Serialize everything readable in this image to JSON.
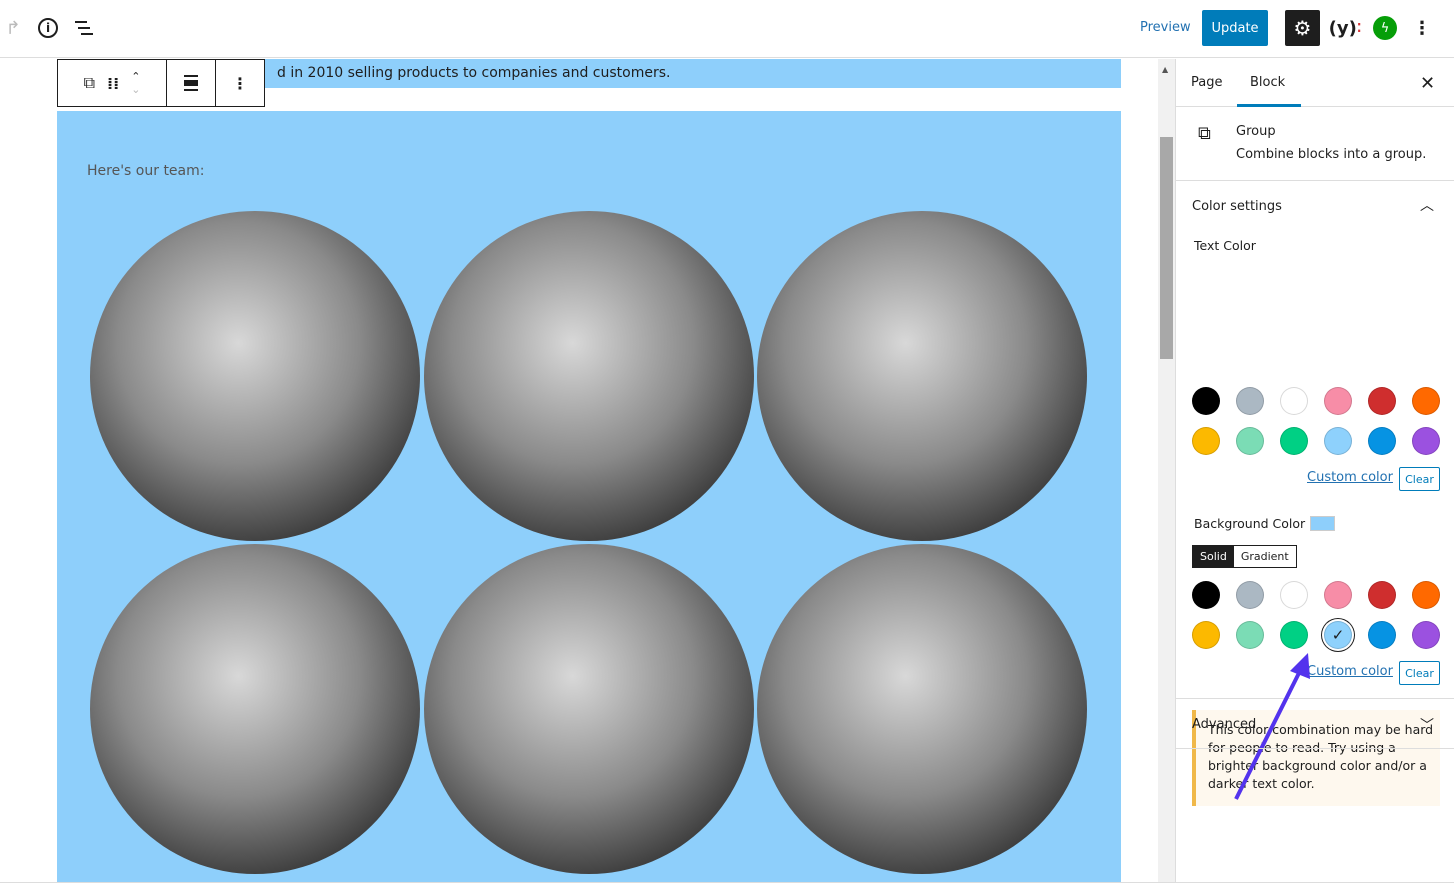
{
  "header": {
    "preview_label": "Preview",
    "update_label": "Update",
    "icons": [
      "redo-icon",
      "info-icon",
      "list-view-icon",
      "settings-gear-icon",
      "yoast-icon",
      "jetpack-icon",
      "more-vertical-icon"
    ]
  },
  "editor": {
    "top_text": "d in 2010 selling products to companies and customers.",
    "team_heading": "Here's our team:",
    "background_color": "#8ecffb",
    "images": 6
  },
  "sidebar": {
    "tabs": [
      {
        "label": "Page"
      },
      {
        "label": "Block",
        "active": true
      }
    ],
    "block": {
      "name": "Group",
      "description": "Combine blocks into a group."
    },
    "color_settings": {
      "title": "Color settings",
      "text_color_label": "Text Color",
      "background_color_label": "Background Color",
      "background_value": "#8ecffb",
      "solid_label": "Solid",
      "gradient_label": "Gradient",
      "custom_color_label": "Custom color",
      "clear_label": "Clear",
      "palette": [
        "#000000",
        "#abb8c3",
        "#ffffff",
        "#f78da7",
        "#cf2e2e",
        "#ff6900",
        "#fcb900",
        "#7bdcb5",
        "#00d084",
        "#8ed1fc",
        "#0693e3",
        "#9b51e0"
      ],
      "selected_background": "#8ed1fc",
      "notice": "This color combination may be hard for people to read. Try using a brighter background color and/or a darker text color."
    },
    "advanced_label": "Advanced"
  }
}
